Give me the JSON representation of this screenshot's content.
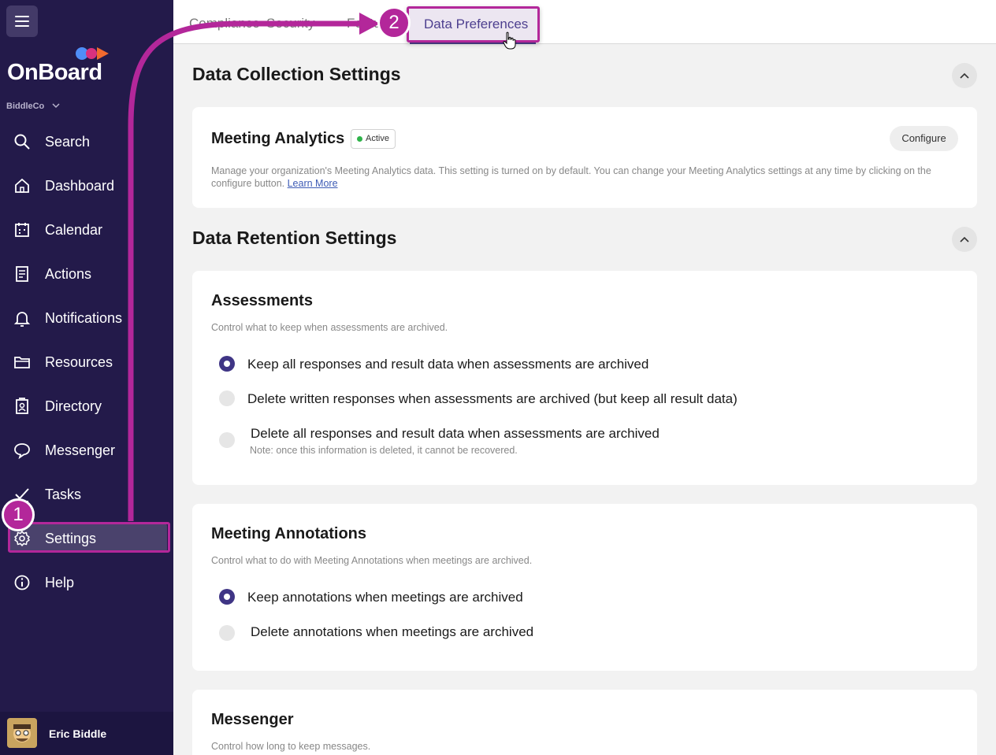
{
  "sidebar": {
    "logo_text": "OnBoard",
    "org_name": "BiddleCo",
    "items": [
      {
        "label": "Search",
        "icon": "search-icon"
      },
      {
        "label": "Dashboard",
        "icon": "home-icon"
      },
      {
        "label": "Calendar",
        "icon": "calendar-icon"
      },
      {
        "label": "Actions",
        "icon": "actions-icon"
      },
      {
        "label": "Notifications",
        "icon": "bell-icon"
      },
      {
        "label": "Resources",
        "icon": "folder-icon"
      },
      {
        "label": "Directory",
        "icon": "directory-icon"
      },
      {
        "label": "Messenger",
        "icon": "chat-icon"
      },
      {
        "label": "Tasks",
        "icon": "check-icon"
      },
      {
        "label": "Settings",
        "icon": "gear-icon",
        "active": true
      },
      {
        "label": "Help",
        "icon": "info-icon"
      }
    ],
    "user_name": "Eric Biddle"
  },
  "tabs": {
    "items": [
      "Compliance",
      "Security",
      "Features",
      "Data Preferences"
    ],
    "active": "Data Preferences"
  },
  "annotations": {
    "step1": "1",
    "step2": "2",
    "accent_color": "#b3279a"
  },
  "data_collection": {
    "title": "Data Collection Settings",
    "meeting_analytics": {
      "title": "Meeting Analytics",
      "status": "Active",
      "configure_label": "Configure",
      "description": "Manage your organization's Meeting Analytics data. This setting is turned on by default. You can change your Meeting Analytics settings at any time by clicking on the configure button.",
      "link_label": "Learn More"
    }
  },
  "data_retention": {
    "title": "Data Retention Settings",
    "assessments": {
      "title": "Assessments",
      "description": "Control what to keep when assessments are archived.",
      "options": [
        {
          "label": "Keep all responses and result data when assessments are archived",
          "checked": true
        },
        {
          "label": "Delete written responses when assessments are archived (but keep all result data)",
          "checked": false
        },
        {
          "label": "Delete all responses and result data when assessments are archived",
          "checked": false,
          "note": "Note: once this information is deleted, it cannot be recovered."
        }
      ]
    },
    "meeting_annotations": {
      "title": "Meeting Annotations",
      "description": "Control what to do with Meeting Annotations when meetings are archived.",
      "options": [
        {
          "label": "Keep annotations when meetings are archived",
          "checked": true
        },
        {
          "label": "Delete annotations when meetings are archived",
          "checked": false
        }
      ]
    },
    "messenger": {
      "title": "Messenger",
      "description": "Control how long to keep messages."
    }
  }
}
